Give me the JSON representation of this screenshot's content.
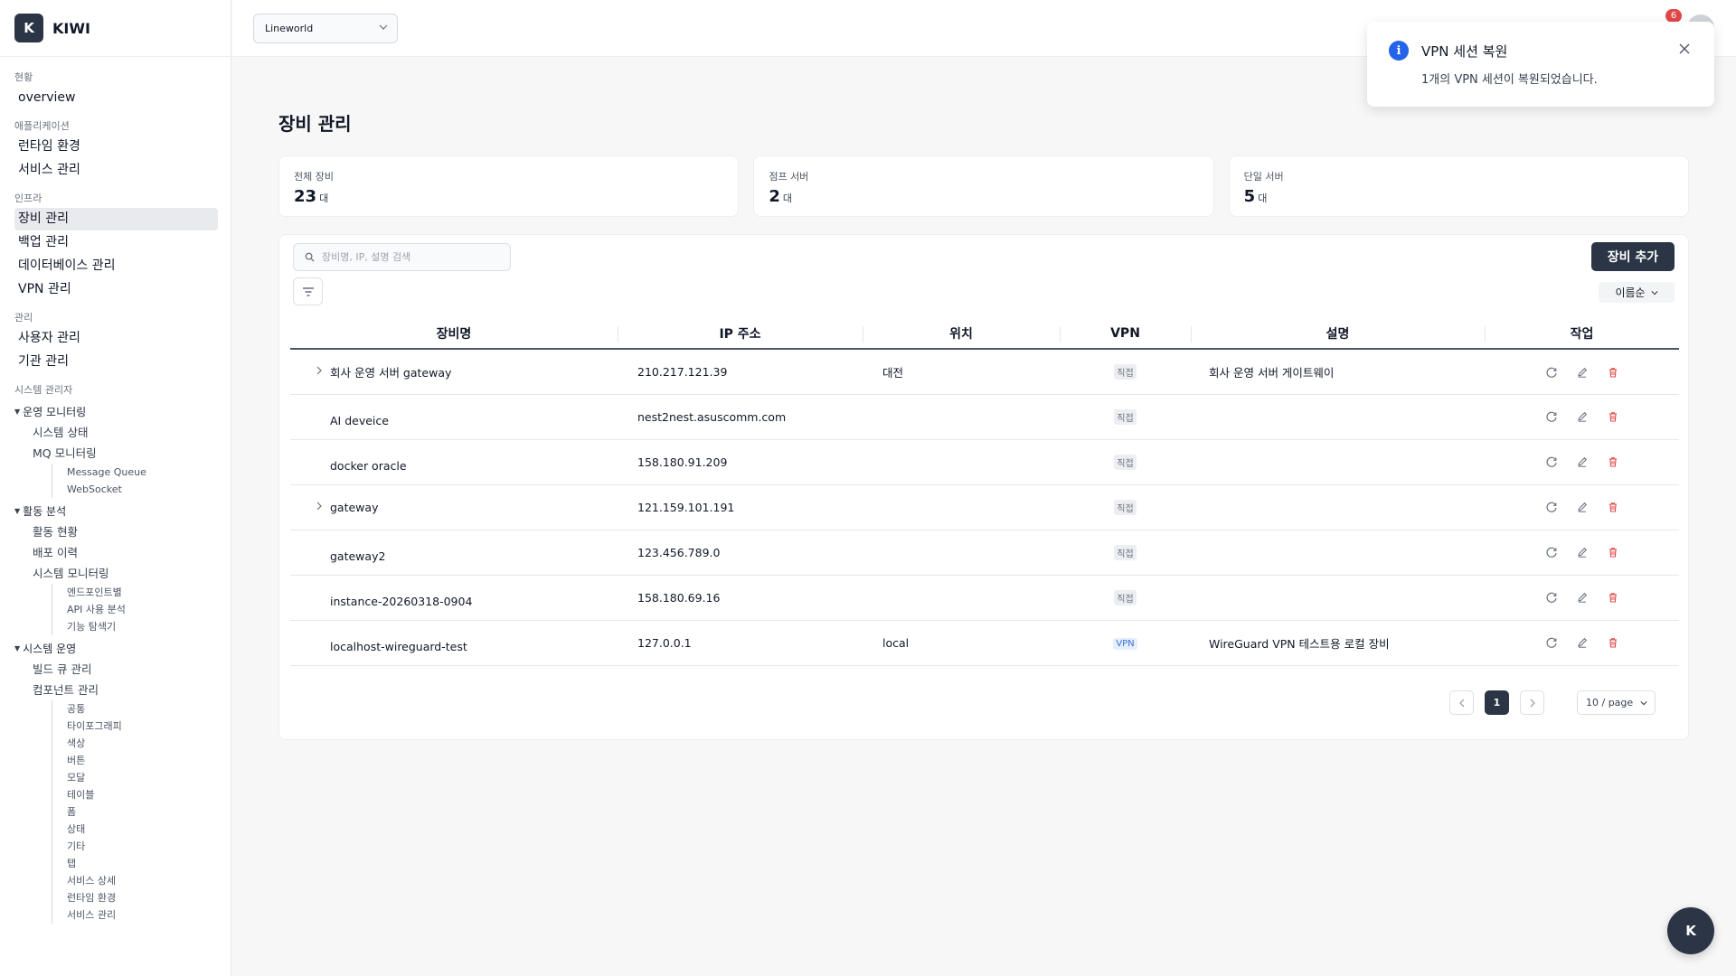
{
  "brand": {
    "logo": "K",
    "name": "KIWI"
  },
  "org_select": {
    "value": "Lineworld"
  },
  "notifications": {
    "count": "6"
  },
  "sidebar": {
    "sections": [
      {
        "title": "현황",
        "items": [
          "overview"
        ]
      },
      {
        "title": "애플리케이션",
        "items": [
          "런타임 환경",
          "서비스 관리"
        ]
      },
      {
        "title": "인프라",
        "items": [
          "장비 관리",
          "백업 관리",
          "데이터베이스 관리",
          "VPN 관리"
        ]
      },
      {
        "title": "관리",
        "items": [
          "사용자 관리",
          "기관 관리"
        ]
      }
    ],
    "admin_title": "시스템 관리자",
    "groups": [
      {
        "title": "운영 모니터링",
        "subs": [
          "시스템 상태",
          "MQ 모니터링"
        ],
        "leaves": [
          "Message Queue",
          "WebSocket"
        ]
      },
      {
        "title": "활동 분석",
        "subs": [
          "활동 현황",
          "배포 이력",
          "시스템 모니터링"
        ],
        "leaves": [
          "엔드포인트별",
          "API 사용 분석",
          "기능 탐색기"
        ]
      },
      {
        "title": "시스템 운영",
        "subs": [
          "빌드 큐 관리",
          "컴포넌트 관리"
        ],
        "leaves": [
          "공통",
          "타이포그래피",
          "색상",
          "버튼",
          "모달",
          "테이블",
          "폼",
          "상태",
          "기타",
          "탭",
          "서비스 상세",
          "런타임 환경",
          "서비스 관리"
        ]
      }
    ]
  },
  "page": {
    "title": "장비 관리"
  },
  "stats": [
    {
      "label": "전체 장비",
      "value": "23",
      "unit": "대"
    },
    {
      "label": "점프 서버",
      "value": "2",
      "unit": "대"
    },
    {
      "label": "단일 서버",
      "value": "5",
      "unit": "대"
    }
  ],
  "search": {
    "placeholder": "장비명, IP, 설명 검색"
  },
  "toolbar": {
    "add_label": "장비 추가",
    "sort_label": "이름순"
  },
  "table": {
    "headers": [
      "장비명",
      "IP 주소",
      "위치",
      "VPN",
      "설명",
      "작업"
    ],
    "rows": [
      {
        "name": "회사 운영 서버 gateway",
        "ip": "210.217.121.39",
        "location": "대전",
        "vpn": "직접",
        "desc": "회사 운영 서버 게이트웨이",
        "expandable": true
      },
      {
        "name": "AI deveice",
        "ip": "nest2nest.asuscomm.com",
        "location": "",
        "vpn": "직접",
        "desc": "",
        "expandable": false
      },
      {
        "name": "docker oracle",
        "ip": "158.180.91.209",
        "location": "",
        "vpn": "직접",
        "desc": "",
        "expandable": false
      },
      {
        "name": "gateway",
        "ip": "121.159.101.191",
        "location": "",
        "vpn": "직접",
        "desc": "",
        "expandable": true
      },
      {
        "name": "gateway2",
        "ip": "123.456.789.0",
        "location": "",
        "vpn": "직접",
        "desc": "",
        "expandable": false
      },
      {
        "name": "instance-20260318-0904",
        "ip": "158.180.69.16",
        "location": "",
        "vpn": "직접",
        "desc": "",
        "expandable": false
      },
      {
        "name": "localhost-wireguard-test",
        "ip": "127.0.0.1",
        "location": "local",
        "vpn": "VPN",
        "desc": "WireGuard VPN 테스트용 로컬 장비",
        "expandable": false
      }
    ]
  },
  "pagination": {
    "current": "1",
    "page_size": "10 / page"
  },
  "toast": {
    "title": "VPN 세션 복원",
    "message": "1개의 VPN 세션이 복원되었습니다."
  },
  "fab": {
    "label": "K"
  },
  "colors": {
    "primary": "#2b3545",
    "danger": "#e04848",
    "info": "#2563eb"
  }
}
